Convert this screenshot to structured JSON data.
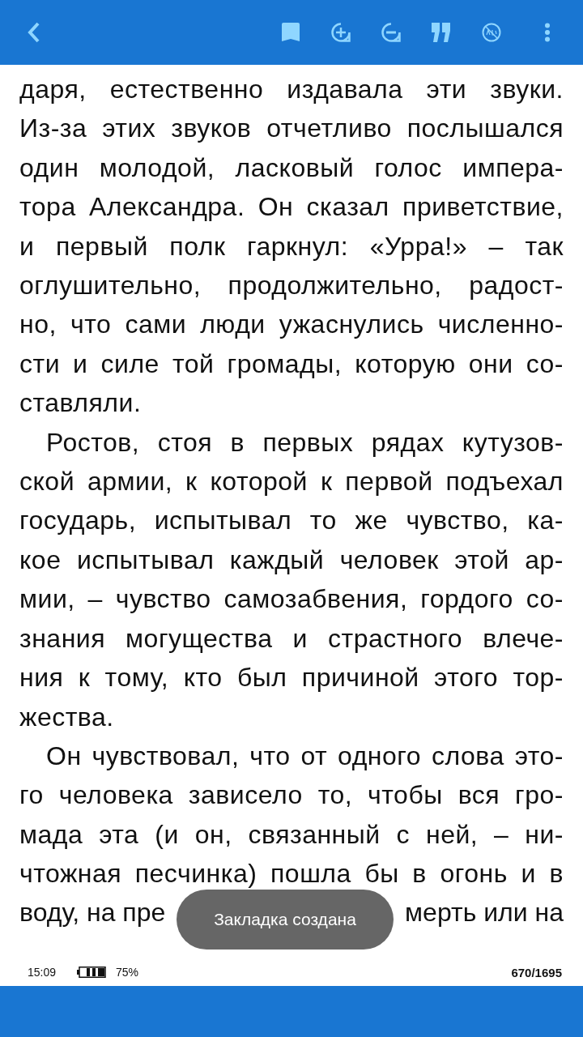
{
  "toolbar": {
    "buttons": [
      {
        "kind": "back"
      },
      {
        "kind": "bookmark"
      },
      {
        "kind": "zoom-in"
      },
      {
        "kind": "zoom-out"
      },
      {
        "kind": "quote"
      },
      {
        "kind": "ads-off"
      },
      {
        "kind": "more"
      }
    ]
  },
  "paragraphs": [
    {
      "indented": false,
      "lines": [
        "даря, естественно издавала эти звуки.",
        "Из-за этих звуков отчетливо послышался",
        "один молодой, ласковый голос импера-",
        "тора Александра. Он сказал приветствие,",
        "и первый полк гаркнул: «Урра!» – так",
        "оглушительно, продолжительно, радост-",
        "но, что сами люди ужаснулись численно-",
        "сти и силе той громады, которую они со-",
        "ставляли."
      ]
    },
    {
      "indented": true,
      "lines": [
        "Ростов, стоя в первых рядах кутузов-",
        "ской армии, к которой к первой подъехал",
        "государь, испытывал то же чувство, ка-",
        "кое испытывал каждый человек этой ар-",
        "мии, – чувство самозабвения, гордого со-",
        "знания могущества и страстного влече-",
        "ния к тому, кто был причиной этого тор-",
        "жества."
      ]
    },
    {
      "indented": true,
      "lines": [
        "Он чувствовал, что от одного слова это-",
        "го человека зависело то, чтобы вся гро-",
        "мада эта (и он, связанный с ней, – ни-",
        "чтожная песчинка) пошла бы в огонь и в",
        [
          "воду, на пре",
          "мерть или на"
        ]
      ]
    }
  ],
  "toast": "Закладка создана",
  "status": {
    "time": "15:09",
    "battery": "75%",
    "page": "670/1695"
  }
}
